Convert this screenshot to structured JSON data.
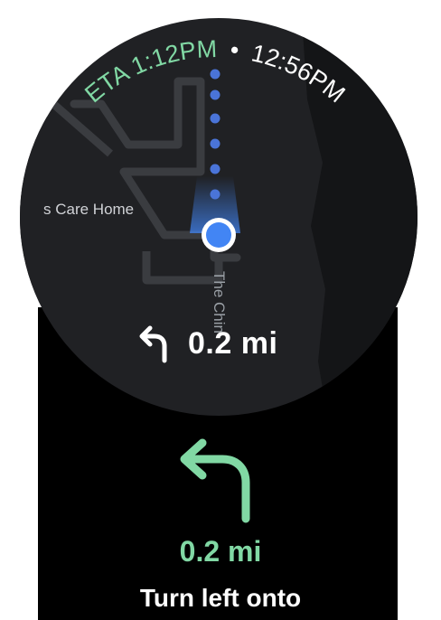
{
  "status": {
    "eta_text": "ETA 1:12PM",
    "separator": "•",
    "current_time": "12:56PM",
    "eta_color": "#81d8a4",
    "time_color": "#ffffff"
  },
  "map": {
    "place_label": "s Care Home",
    "road_label": "The Chin"
  },
  "map_overlay": {
    "distance": "0.2 mi",
    "turn_icon": "turn-left-icon"
  },
  "next_step": {
    "turn_icon": "turn-left-icon",
    "distance": "0.2 mi",
    "instruction": "Turn left onto",
    "accent_color": "#81d8a4"
  },
  "colors": {
    "location_dot": "#4285f4",
    "route_dots": "#4a74d8",
    "map_background": "#202124"
  }
}
